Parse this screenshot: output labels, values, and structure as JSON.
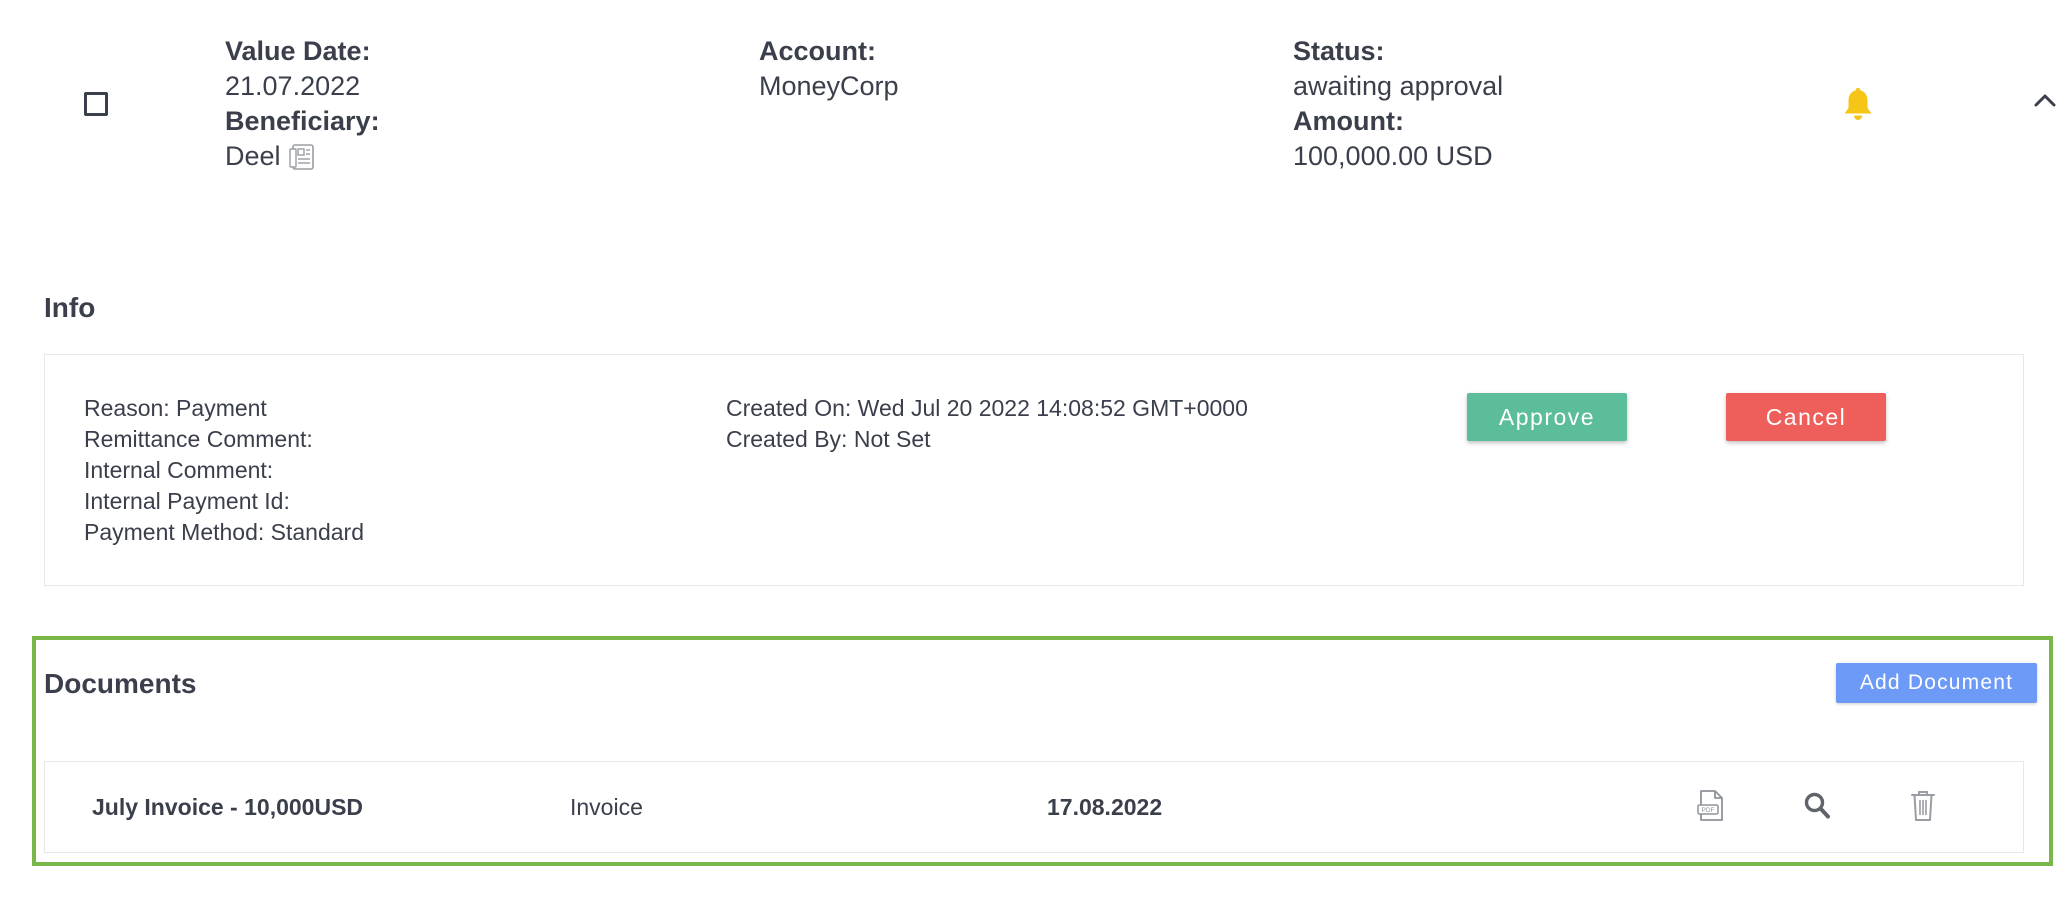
{
  "payment": {
    "value_date_label": "Value Date:",
    "value_date": "21.07.2022",
    "beneficiary_label": "Beneficiary:",
    "beneficiary": "Deel",
    "account_label": "Account:",
    "account": "MoneyCorp",
    "status_label": "Status:",
    "status": "awaiting approval",
    "amount_label": "Amount:",
    "amount": "100,000.00 USD"
  },
  "info": {
    "title": "Info",
    "left_lines": [
      "Reason: Payment",
      "Remittance Comment:",
      "Internal Comment:",
      "Internal Payment Id:",
      "Payment Method: Standard"
    ],
    "right_lines": [
      "Created On: Wed Jul 20 2022 14:08:52 GMT+0000",
      "Created By: Not Set"
    ],
    "approve_label": "Approve",
    "cancel_label": "Cancel"
  },
  "documents": {
    "title": "Documents",
    "add_label": "Add Document",
    "rows": [
      {
        "name": "July Invoice - 10,000USD",
        "type": "Invoice",
        "date": "17.08.2022"
      }
    ]
  },
  "icons": {
    "checkbox": "checkbox-icon",
    "beneficiary_card": "contact-card-icon",
    "bell": "bell-icon",
    "chevron": "chevron-up-icon",
    "pdf": "pdf-file-icon",
    "search": "search-icon",
    "trash": "trash-icon"
  },
  "colors": {
    "approve": "#5bbd99",
    "cancel": "#ee5f5b",
    "add_document": "#6e9af7",
    "bell": "#f5c518",
    "highlight_border": "#7ab648"
  }
}
